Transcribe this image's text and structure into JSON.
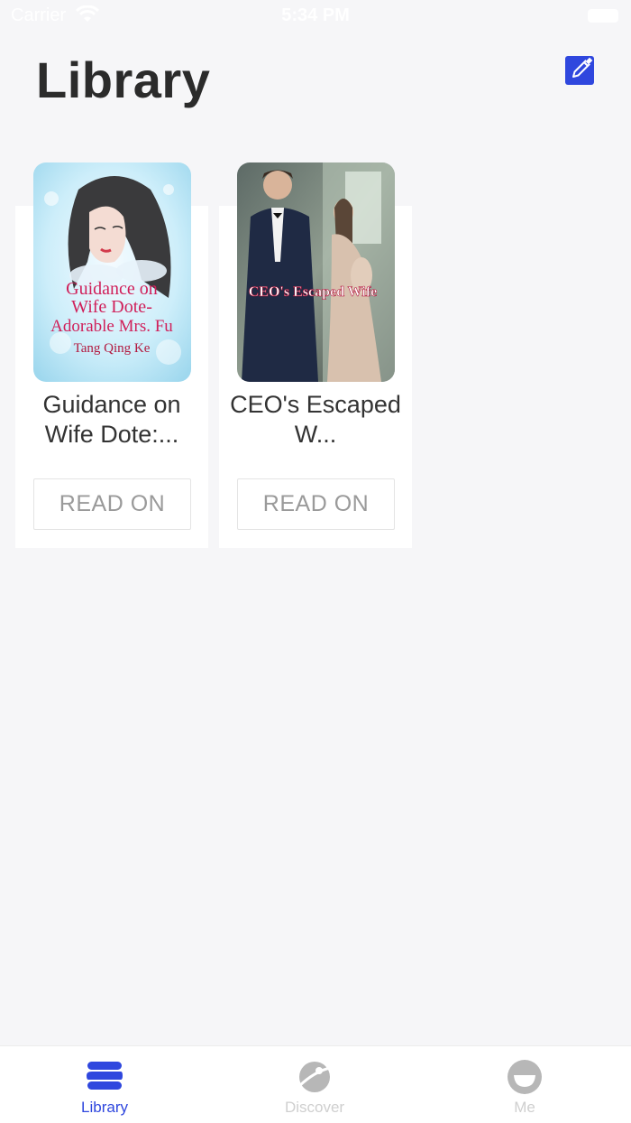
{
  "status_bar": {
    "carrier": "Carrier",
    "time": "5:34 PM"
  },
  "header": {
    "title": "Library",
    "edit_icon": "pencil-square-icon"
  },
  "books": [
    {
      "title": "Guidance on Wife Dote:...",
      "cover_text_lines": [
        "Guidance on",
        "Wife Dote-",
        "Adorable Mrs. Fu"
      ],
      "cover_author": "Tang Qing Ke",
      "button_label": "READ ON"
    },
    {
      "title": "CEO's Escaped W...",
      "cover_text": "CEO's Escaped Wife",
      "button_label": "READ ON"
    }
  ],
  "tab_bar": {
    "tabs": [
      {
        "label": "Library",
        "icon": "library-stack-icon",
        "active": true
      },
      {
        "label": "Discover",
        "icon": "planet-icon",
        "active": false
      },
      {
        "label": "Me",
        "icon": "smiley-face-icon",
        "active": false
      }
    ]
  },
  "colors": {
    "accent": "#2f47de",
    "inactive": "#cfcfcf",
    "background": "#f6f6f8"
  }
}
